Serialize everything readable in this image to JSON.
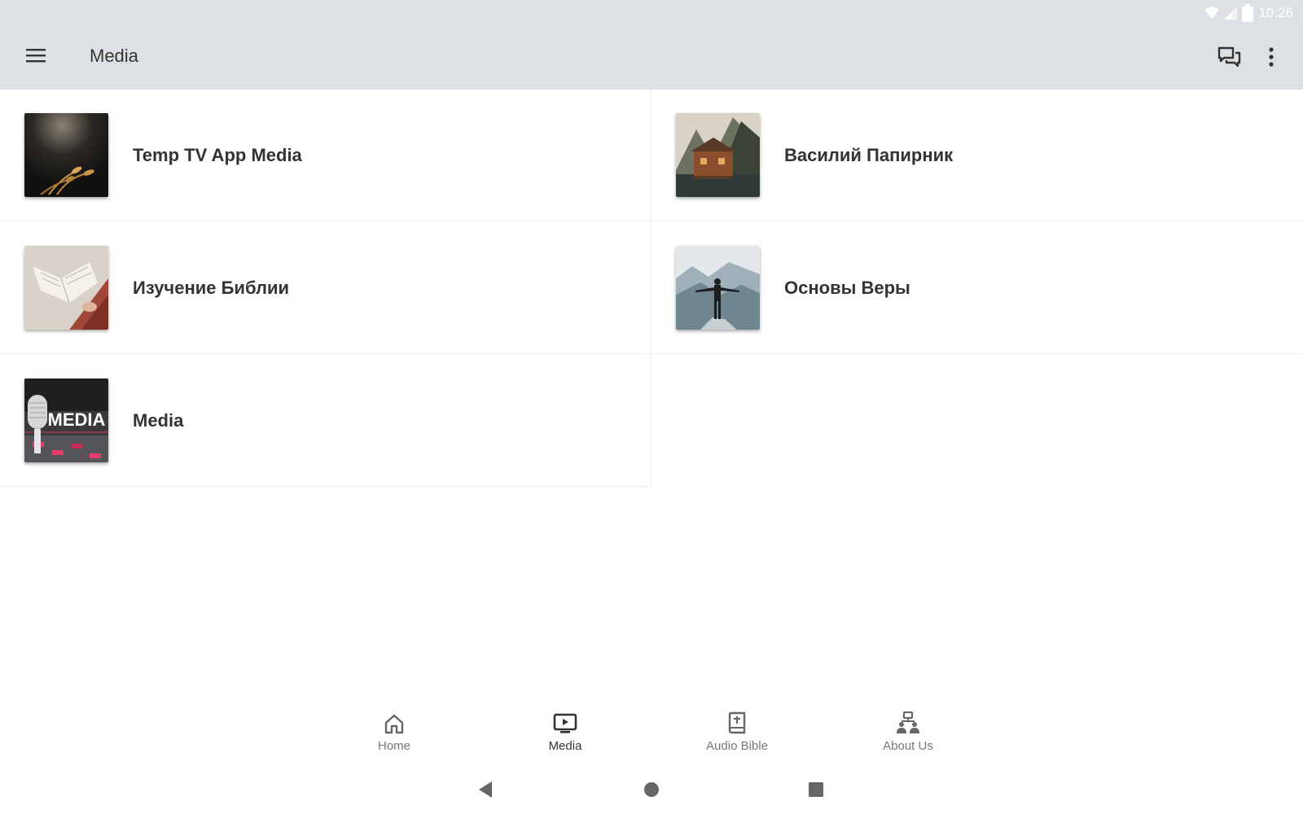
{
  "status_bar": {
    "time": "10:26",
    "icons": [
      "wifi-icon",
      "signal-icon",
      "battery-icon"
    ]
  },
  "app_bar": {
    "title": "Media",
    "menu_icon": "hamburger-menu-icon",
    "chat_icon": "chat-icon",
    "more_icon": "more-vert-icon"
  },
  "tiles": [
    {
      "label": "Temp TV App Media",
      "thumb": "dark-wheat-photo"
    },
    {
      "label": "Василий Папирник",
      "thumb": "lake-cabin-photo"
    },
    {
      "label": "Изучение Библии",
      "thumb": "reading-book-photo"
    },
    {
      "label": "Основы Веры",
      "thumb": "mountain-man-photo"
    },
    {
      "label": "Media",
      "thumb": "microphone-media-photo",
      "thumb_text": "MEDIA"
    }
  ],
  "bottom_nav": {
    "items": [
      {
        "label": "Home",
        "icon": "home-icon",
        "active": false
      },
      {
        "label": "Media",
        "icon": "tv-play-icon",
        "active": true
      },
      {
        "label": "Audio Bible",
        "icon": "bible-icon",
        "active": false
      },
      {
        "label": "About Us",
        "icon": "people-org-icon",
        "active": false
      }
    ]
  },
  "system_nav": {
    "icons": [
      "back-icon",
      "home-circle-icon",
      "recents-icon"
    ]
  },
  "colors": {
    "app_bar": "#dee1e3",
    "text": "#333333",
    "inactive": "#777777",
    "divider": "#ececec"
  }
}
